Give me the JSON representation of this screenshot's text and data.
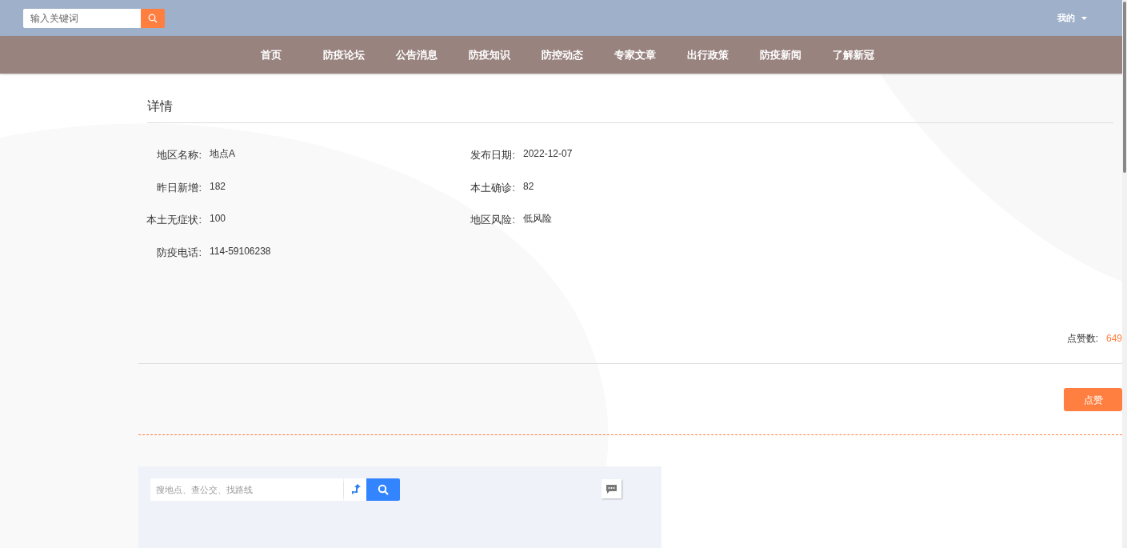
{
  "header": {
    "search": {
      "placeholder": "输入关键词"
    },
    "user_menu": "我的"
  },
  "nav": [
    {
      "label": "首页"
    },
    {
      "label": "防疫论坛"
    },
    {
      "label": "公告消息"
    },
    {
      "label": "防疫知识"
    },
    {
      "label": "防控动态"
    },
    {
      "label": "专家文章"
    },
    {
      "label": "出行政策"
    },
    {
      "label": "防疫新闻"
    },
    {
      "label": "了解新冠"
    }
  ],
  "detail": {
    "title": "详情",
    "fields": [
      {
        "label": "地区名称:",
        "value": "地点A"
      },
      {
        "label": "发布日期:",
        "value": "2022-12-07"
      },
      {
        "label": "昨日新增:",
        "value": "182"
      },
      {
        "label": "本土确诊:",
        "value": "82"
      },
      {
        "label": "本土无症状:",
        "value": "100"
      },
      {
        "label": "地区风险:",
        "value": "低风险"
      },
      {
        "label": "防疫电话:",
        "value": "114-59106238"
      }
    ],
    "likes_label": "点赞数:",
    "likes": "649",
    "like_button": "点赞"
  },
  "map": {
    "search": {
      "placeholder": "搜地点、查公交、找路线"
    }
  }
}
